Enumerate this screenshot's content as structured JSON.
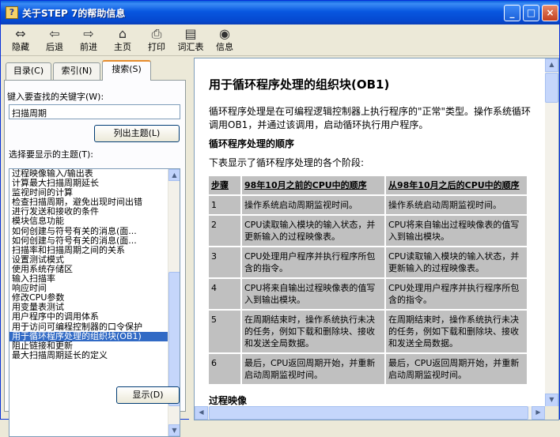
{
  "window": {
    "title": "关于STEP 7的帮助信息",
    "title_icon": "?"
  },
  "title_buttons": {
    "minimize": "_",
    "maximize": "□",
    "close": "×"
  },
  "toolbar": [
    {
      "label": "隐藏",
      "icon": "⇔"
    },
    {
      "label": "后退",
      "icon": "⇦"
    },
    {
      "label": "前进",
      "icon": "⇨"
    },
    {
      "label": "主页",
      "icon": "⌂"
    },
    {
      "label": "打印",
      "icon": "⎙"
    },
    {
      "label": "词汇表",
      "icon": "▤"
    },
    {
      "label": "信息",
      "icon": "◉"
    }
  ],
  "tabs": [
    {
      "label": "目录(C)"
    },
    {
      "label": "索引(N)"
    },
    {
      "label": "搜索(S)"
    }
  ],
  "search": {
    "keyword_label": "键入要查找的关键字(W):",
    "keyword_value": "扫描周期",
    "list_topics_button": "列出主题(L)",
    "select_label": "选择要显示的主题(T):",
    "display_button": "显示(D)",
    "selected_index": 19,
    "topics": [
      "过程映像输入/输出表",
      "计算最大扫描周期延长",
      "监视时间的计算",
      "检查扫描周期，避免出现时间出错",
      "进行发送和接收的条件",
      "模块信息功能",
      "如何创建与符号有关的消息(面...",
      "如何创建与符号有关的消息(面...",
      "扫描率和扫描周期之间的关系",
      "设置测试模式",
      "使用系统存储区",
      "输入扫描率",
      "响应时间",
      "修改CPU参数",
      "用变量表测试",
      "用户程序中的调用体系",
      "用于访问可编程控制器的口令保护",
      "用于循环程序处理的组织块(OB1)",
      "阻止链接和更新",
      "最大扫描周期延长的定义"
    ]
  },
  "article": {
    "title": "用于循环程序处理的组织块(OB1)",
    "intro": "循环程序处理是在可编程逻辑控制器上执行程序的\"正常\"类型。操作系统循环调用OB1，并通过该调用，启动循环执行用户程序。",
    "section_title": "循环程序处理的顺序",
    "table_intro": "下表显示了循环程序处理的各个阶段:",
    "table_headers": [
      "步骤",
      "98年10月之前的CPU中的顺序",
      "从98年10月之后的CPU中的顺序"
    ],
    "table_rows": [
      [
        "1",
        "操作系统启动周期监视时间。",
        "操作系统启动周期监视时间。"
      ],
      [
        "2",
        "CPU读取输入模块的输入状态，并更新输入的过程映像表。",
        "CPU将来自输出过程映像表的值写入到输出模块。"
      ],
      [
        "3",
        "CPU处理用户程序并执行程序所包含的指令。",
        "CPU读取输入模块的输入状态，并更新输入的过程映像表。"
      ],
      [
        "4",
        "CPU将来自输出过程映像表的值写入到输出模块。",
        "CPU处理用户程序并执行程序所包含的指令。"
      ],
      [
        "5",
        "在周期结束时，操作系统执行未决的任务，例如下载和删除块、接收和发送全局数据。",
        "在周期结束时，操作系统执行未决的任务，例如下载和删除块、接收和发送全局数据。"
      ],
      [
        "6",
        "最后，CPU返回周期开始，并重新启动周期监视时间。",
        "最后，CPU返回周期开始，并重新启动周期监视时间。"
      ]
    ],
    "next_heading": "过程映像"
  }
}
